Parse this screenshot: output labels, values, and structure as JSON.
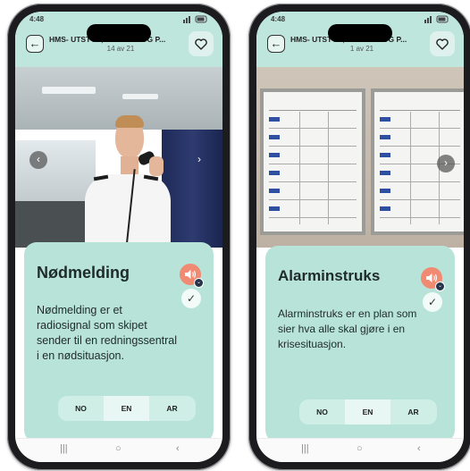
{
  "phones": [
    {
      "status_time": "4:48",
      "title": "HMS- UTSTYR, RUTINER OG P...",
      "counter": "14 av 21",
      "card_title": "Nødmelding",
      "card_description": "Nødmelding er et radiosignal som skipet sender til en redningssentral i en nødsituasjon.",
      "languages": [
        "NO",
        "EN",
        "AR"
      ],
      "active_language": "EN"
    },
    {
      "status_time": "4:48",
      "title": "HMS- UTSTYR, RUTINER OG P...",
      "counter": "1 av 21",
      "card_title": "Alarminstruks",
      "card_description": "Alarminstruks er en plan som sier hva alle skal gjøre i en krisesituasjon.",
      "languages": [
        "NO",
        "EN",
        "AR"
      ],
      "active_language": "EN"
    }
  ],
  "icons": {
    "back": "arrow-left-icon",
    "favorite": "heart-icon",
    "audio": "speaker-icon",
    "done": "check-icon",
    "prev": "chevron-left-icon",
    "next": "chevron-right-icon",
    "nav_recent": "recent-apps-icon",
    "nav_home": "home-icon",
    "nav_back": "back-icon"
  },
  "colors": {
    "header_bg": "#bfe6dc",
    "card_bg": "#b7e3d9",
    "speaker_accent": "#f08a72"
  }
}
